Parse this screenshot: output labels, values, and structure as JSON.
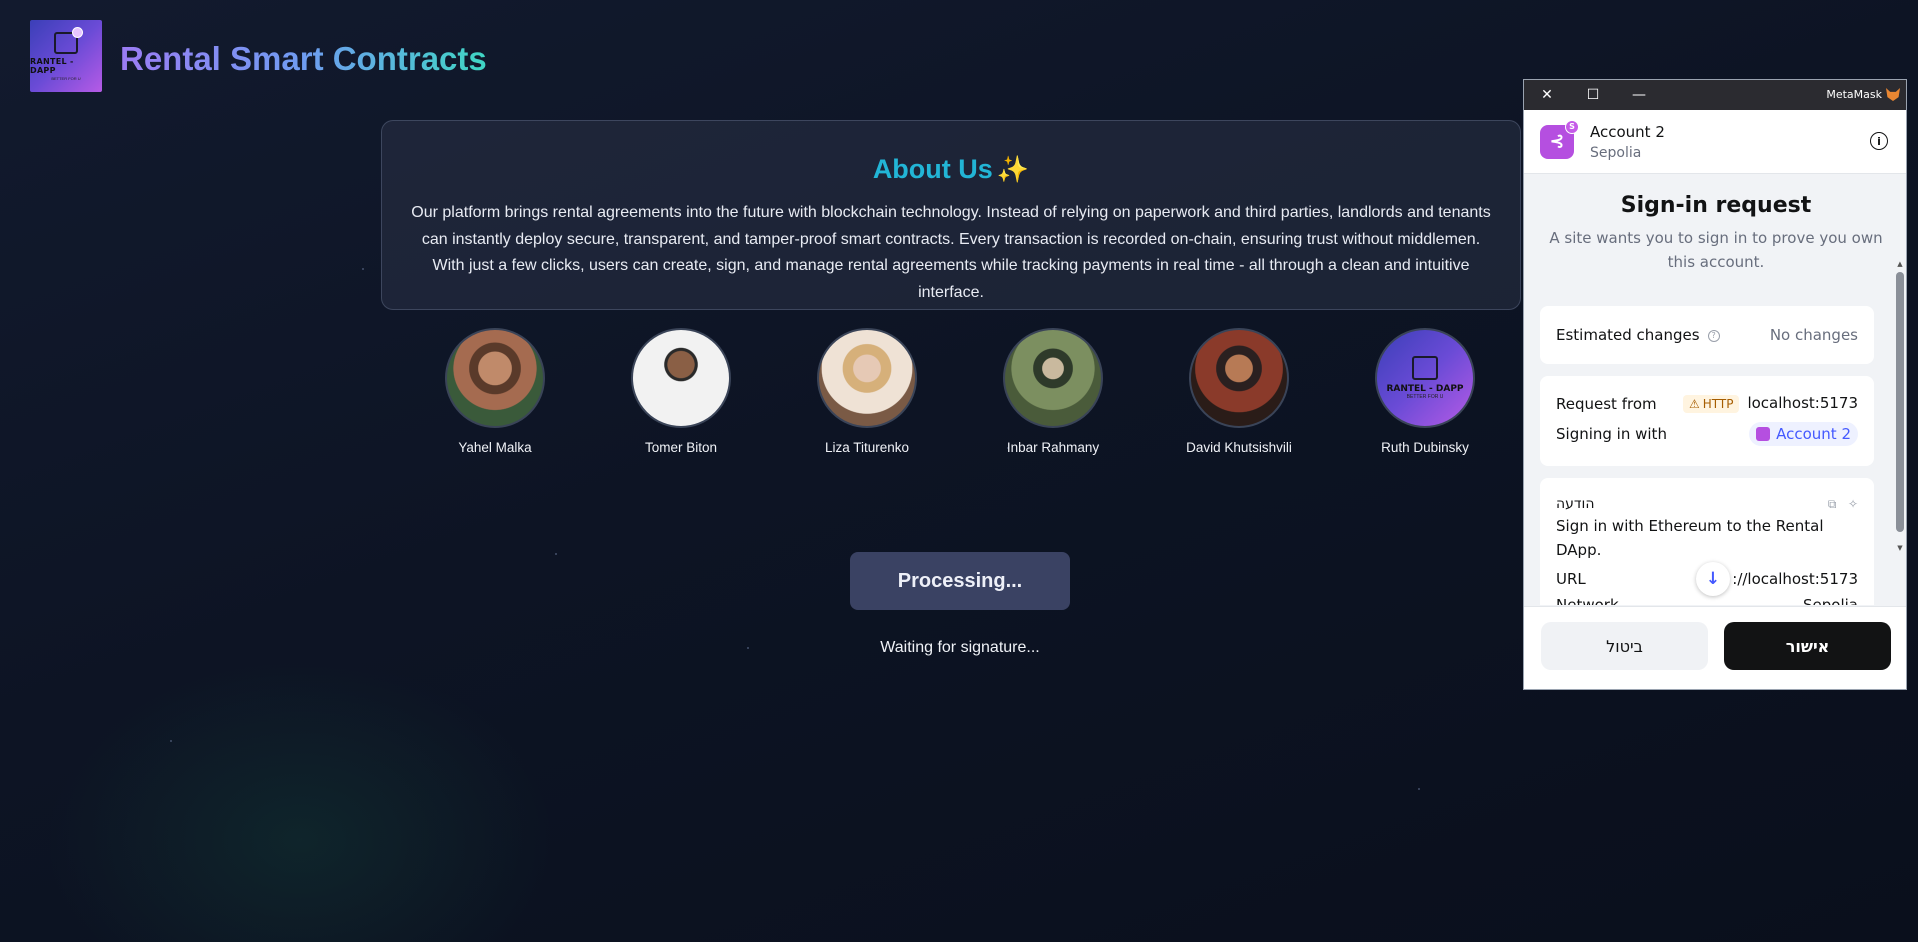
{
  "site": {
    "logo": {
      "title": "RANTEL - DAPP",
      "tagline": "BETTER FOR U"
    },
    "title": "Rental Smart Contracts"
  },
  "about": {
    "heading": "About Us",
    "sparkle": "✨",
    "text": "Our platform brings rental agreements into the future with blockchain technology. Instead of relying on paperwork and third parties, landlords and tenants can instantly deploy secure, transparent, and tamper-proof smart contracts. Every transaction is recorded on-chain, ensuring trust without middlemen. With just a few clicks, users can create, sign, and manage rental agreements while tracking payments in real time - all through a clean and intuitive interface."
  },
  "team": [
    {
      "name": "Yahel Malka"
    },
    {
      "name": "Tomer Biton"
    },
    {
      "name": "Liza Titurenko"
    },
    {
      "name": "Inbar Rahmany"
    },
    {
      "name": "David Khutsishvili"
    },
    {
      "name": "Ruth Dubinsky"
    }
  ],
  "status": {
    "button_label": "Processing...",
    "message": "Waiting for signature..."
  },
  "metamask": {
    "window_title": "MetaMask",
    "account_name": "Account 2",
    "network": "Sepolia",
    "heading": "Sign-in request",
    "subtitle": "A site wants you to sign in to prove you own this account.",
    "estimated_changes_label": "Estimated changes",
    "estimated_changes_value": "No changes",
    "request_from_label": "Request from",
    "http_badge": "HTTP",
    "request_from_value": "localhost:5173",
    "signing_in_label": "Signing in with",
    "signing_in_account": "Account 2",
    "message_label": "הודעה",
    "message_text": "Sign in with Ethereum to the Rental DApp.",
    "url_label": "URL",
    "url_value": "://localhost:5173",
    "network_label": "Network",
    "network_value": "Sepolia",
    "cancel_label": "ביטול",
    "confirm_label": "אישור"
  }
}
